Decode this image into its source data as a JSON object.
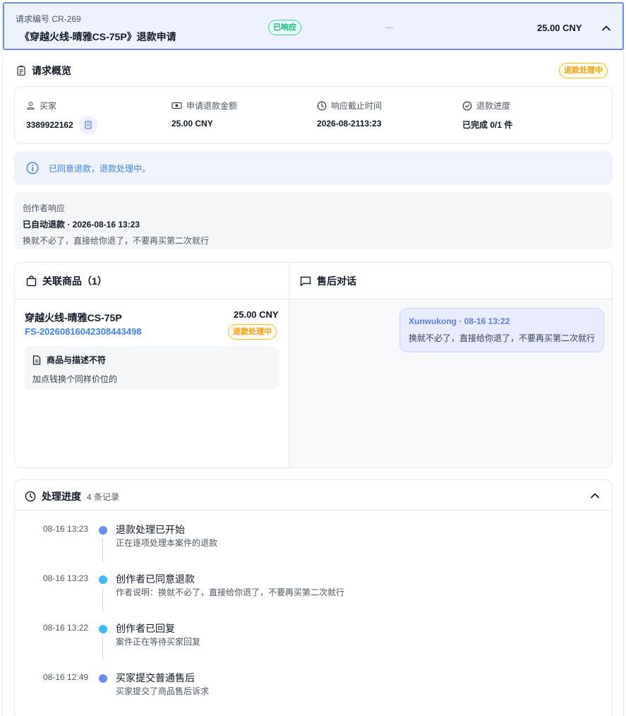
{
  "header": {
    "request_id": "请求编号 CR-269",
    "title": "《穿越火线-晴雅CS-75P》退款申请",
    "status_badge": "已响应",
    "dash": "—",
    "amount": "25.00 CNY"
  },
  "overview": {
    "title": "请求概览",
    "status_badge": "退款处理中",
    "buyer_label": "买家",
    "buyer_value": "3389922162",
    "refund_amount_label": "申请退款金额",
    "refund_amount_value": "25.00 CNY",
    "deadline_label": "响应截止时间",
    "deadline_value": "2026-08-2113:23",
    "progress_label": "退款进度",
    "progress_value": "已完成 0/1 件"
  },
  "info_bar": {
    "text": "已同意退款，退款处理中。"
  },
  "creator_response": {
    "label": "创作者响应",
    "headline": "已自动退款 · 2026-08-16 13:23",
    "message": "换就不必了，直接给你退了，不要再买第二次就行"
  },
  "products": {
    "title": "关联商品（1）",
    "items": [
      {
        "name": "穿越火线-晴雅CS-75P",
        "price": "25.00 CNY",
        "sku": "FS-20260816042308443498",
        "status": "退款处理中",
        "reason_title": "商品与描述不符",
        "reason_detail": "加点钱换个同样价位的"
      }
    ]
  },
  "chat": {
    "title": "售后对话",
    "messages": [
      {
        "header": "Xunwukong · 08-16 13:22",
        "text": "换就不必了，直接给你退了，不要再买第二次就行"
      }
    ]
  },
  "progress": {
    "title": "处理进度",
    "count": "4 条记录",
    "events": [
      {
        "time": "08-16 13:23",
        "title": "退款处理已开始",
        "desc": "正在逐项处理本案件的退款",
        "color": "#6b8cf0"
      },
      {
        "time": "08-16 13:23",
        "title": "创作者已同意退款",
        "desc": "作者说明：换就不必了，直接给你退了，不要再买第二次就行",
        "color": "#38bdf8"
      },
      {
        "time": "08-16 13:22",
        "title": "创作者已回复",
        "desc": "案件正在等待买家回复",
        "color": "#38bdf8"
      },
      {
        "time": "08-16 12:49",
        "title": "买家提交普通售后",
        "desc": "买家提交了商品售后诉求",
        "color": "#6b8cf0"
      }
    ]
  },
  "colors": {
    "accent": "#6b8cf0",
    "link": "#3b82f6",
    "success": "#10b981",
    "warning": "#f59e0b"
  },
  "icons": [
    "chevron-up-icon",
    "clipboard-icon",
    "user-icon",
    "banknote-icon",
    "clock-icon",
    "check-circle-icon",
    "copy-icon",
    "info-icon",
    "shopping-bag-icon",
    "chat-icon",
    "document-icon"
  ]
}
